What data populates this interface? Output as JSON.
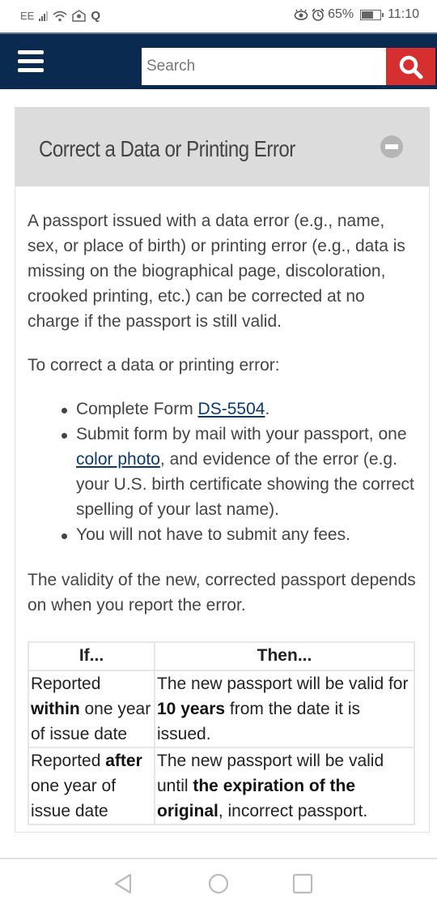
{
  "status_bar": {
    "carrier": "EE",
    "battery_percent": "65%",
    "battery_level": 0.65,
    "time": "11:10",
    "icons_left": [
      "signal-icon",
      "wifi-icon",
      "mail-icon",
      "q-app-icon"
    ],
    "icons_right": [
      "eye-comfort-icon",
      "alarm-icon",
      "battery-icon"
    ]
  },
  "header": {
    "search_placeholder": "Search",
    "search_value": "",
    "colors": {
      "background": "#0b2a4f",
      "search_button": "#d52f2f"
    }
  },
  "accordion": {
    "title": "Correct a Data or Printing Error",
    "expanded": true,
    "intro": "A passport issued with a data error (e.g., name, sex, or place of birth) or printing error (e.g., data is missing on the biographical page, discoloration, crooked printing, etc.) can be corrected at no charge if the passport is still valid.",
    "steps_heading": "To correct a data or printing error:",
    "bullets": [
      {
        "before": "Complete Form ",
        "link": "DS-5504",
        "after": "."
      },
      {
        "before": "Submit form by mail with your passport, one ",
        "link": "color photo",
        "after": ", and evidence of the error (e.g. your U.S. birth certificate showing the correct spelling of your last name)."
      },
      {
        "before": "You will not have to submit any fees.",
        "link": "",
        "after": ""
      }
    ],
    "validity_text": "The validity of the new, corrected passport depends on when you report the error.",
    "table": {
      "headers": [
        "If...",
        "Then..."
      ],
      "rows": [
        {
          "if_pre": "Reported ",
          "if_bold": "within",
          "if_post": " one year of issue date",
          "then_pre": "The new passport will be valid for ",
          "then_bold": "10 years",
          "then_post": " from the date it is issued."
        },
        {
          "if_pre": "Reported ",
          "if_bold": "after",
          "if_post": " one year of issue date",
          "then_pre": "The new passport will be valid until ",
          "then_bold": "the expiration of the original",
          "then_post": ", incorrect passport."
        }
      ]
    }
  },
  "nav_bar": {
    "buttons": [
      "back",
      "home",
      "recents"
    ]
  }
}
